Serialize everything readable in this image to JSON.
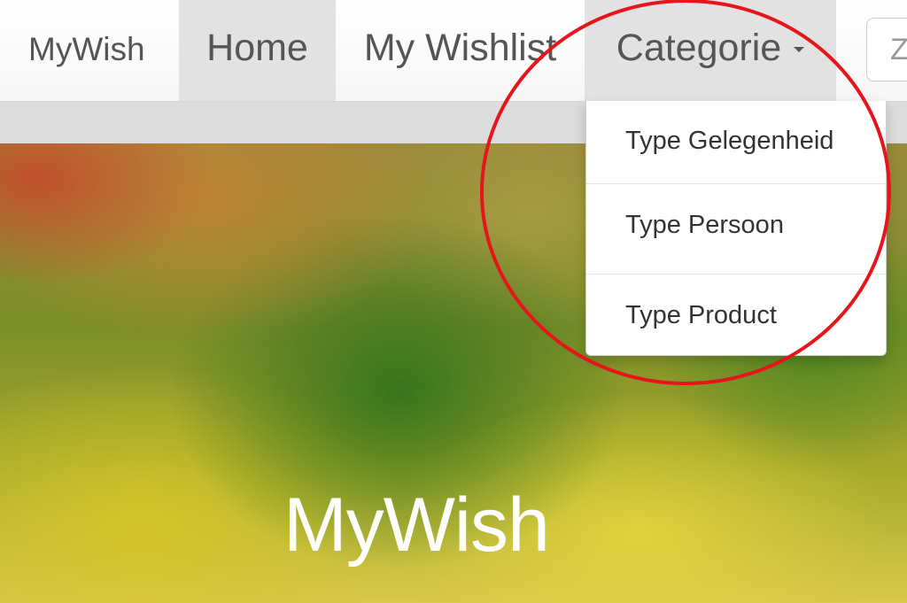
{
  "navbar": {
    "brand": "MyWish",
    "items": [
      {
        "label": "Home",
        "active": true
      },
      {
        "label": "My Wishlist",
        "active": false
      },
      {
        "label": "Categorie",
        "active": true,
        "has_dropdown": true
      }
    ],
    "search_placeholder": "Zo"
  },
  "dropdown": {
    "open": true,
    "items": [
      {
        "label": "Type Gelegenheid"
      },
      {
        "label": "Type Persoon"
      },
      {
        "label": "Type Product"
      }
    ]
  },
  "hero": {
    "title": "MyWish"
  },
  "annotation": {
    "shape": "ellipse",
    "color": "#e8141b"
  },
  "colors": {
    "nav_text": "#555555",
    "active_tab_bg": "#e2e2e2",
    "dropdown_text": "#333333"
  }
}
